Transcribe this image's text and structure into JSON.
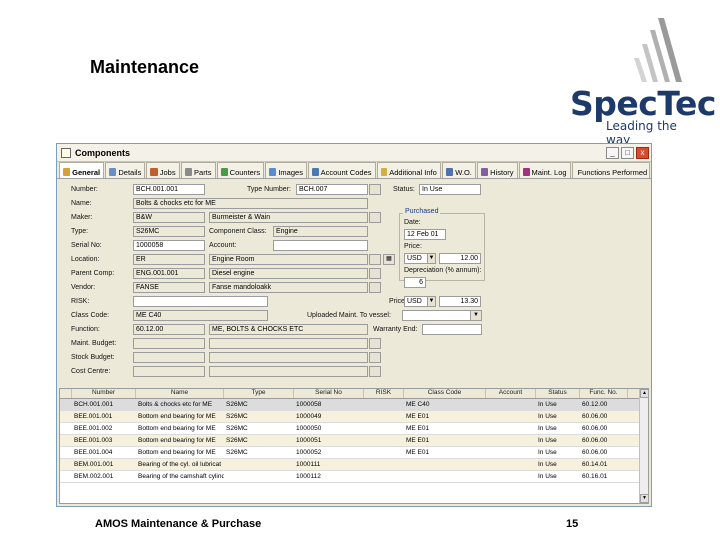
{
  "slide": {
    "title": "Maintenance",
    "footer_left": "AMOS Maintenance & Purchase",
    "page_number": "15"
  },
  "logo": {
    "brand": "SpecTec",
    "tagline": "Leading the way"
  },
  "window": {
    "title": "Components",
    "buttons": {
      "minimize": "_",
      "maximize": "□",
      "close": "x"
    }
  },
  "tabs": [
    {
      "label": "General",
      "icon": "general-icon",
      "color": "#d7a13a"
    },
    {
      "label": "Details",
      "icon": "details-icon",
      "color": "#6b8fc4"
    },
    {
      "label": "Jobs",
      "icon": "jobs-icon",
      "color": "#c06030"
    },
    {
      "label": "Parts",
      "icon": "parts-icon",
      "color": "#8a8a8a"
    },
    {
      "label": "Counters",
      "icon": "counters-icon",
      "color": "#4a9a4a"
    },
    {
      "label": "Images",
      "icon": "images-icon",
      "color": "#5a8ad0"
    },
    {
      "label": "Account Codes",
      "icon": "account-codes-icon",
      "color": "#4a7ab0"
    },
    {
      "label": "Additional Info",
      "icon": "info-icon",
      "color": "#d0b040"
    },
    {
      "label": "W.O.",
      "icon": "work-order-icon",
      "color": "#5070b0"
    },
    {
      "label": "History",
      "icon": "history-icon",
      "color": "#8060a0"
    },
    {
      "label": "Maint. Log",
      "icon": "maint-log-icon",
      "color": "#a03080"
    },
    {
      "label": "Functions Performed",
      "icon": "functions-icon",
      "color": "#409040"
    }
  ],
  "form": {
    "number": {
      "label": "Number:",
      "value": "BCH.001.001"
    },
    "type_number": {
      "label": "Type Number:",
      "value": "BCH.007"
    },
    "status": {
      "label": "Status:",
      "value": "In Use"
    },
    "name": {
      "label": "Name:",
      "value": "Bolts & chocks etc for ME"
    },
    "maker": {
      "label": "Maker:",
      "value": "B&W",
      "extra": "Burmeister & Wain"
    },
    "type": {
      "label": "Type:",
      "value": "S26MC",
      "component_class_label": "Component Class:",
      "component_class": "Engine"
    },
    "serial_no": {
      "label": "Serial No:",
      "value": "1000058",
      "account_label": "Account:",
      "account": ""
    },
    "location": {
      "label": "Location:",
      "value": "ER",
      "extra": "Engine Room"
    },
    "parent_comp": {
      "label": "Parent Comp:",
      "value": "ENG.001.001",
      "extra": "Diesel engine"
    },
    "vendor": {
      "label": "Vendor:",
      "value": "FANSE",
      "extra": "Fanse mandoloakk"
    },
    "risk": {
      "label": "RISK:",
      "value": ""
    },
    "class_code": {
      "label": "Class Code:",
      "value": "ME C40",
      "uploaded_label": "Uploaded Maint. To vessel:"
    },
    "function": {
      "label": "Function:",
      "value": "60.12.00",
      "extra": "ME, BOLTS & CHOCKS ETC",
      "warranty_label": "Warranty End:"
    },
    "maint_budget": {
      "label": "Maint. Budget:"
    },
    "stock_budget": {
      "label": "Stock Budget:"
    },
    "cost_centre": {
      "label": "Cost Centre:"
    },
    "purchased": {
      "title": "Purchased",
      "date_label": "Date:",
      "date": "12 Feb 01",
      "price_label": "Price:",
      "currency": "USD",
      "price": "12.00",
      "depreciation_label": "Depreciation (% annum):",
      "depreciation": "6"
    },
    "price": {
      "label": "Price:",
      "currency": "USD",
      "value": "13.30"
    }
  },
  "grid": {
    "columns": [
      "Number",
      "Name",
      "Type",
      "Serial No",
      "RISK",
      "Class Code",
      "Account",
      "Status",
      "Func. No."
    ],
    "rows": [
      [
        "BCH.001.001",
        "Bolts & chocks etc for ME",
        "S26MC",
        "1000058",
        "",
        "ME C40",
        "",
        "In Use",
        "60.12.00"
      ],
      [
        "BEE.001.001",
        "Bottom end bearing for ME",
        "S26MC",
        "1000049",
        "",
        "ME E01",
        "",
        "In Use",
        "60.06.00"
      ],
      [
        "BEE.001.002",
        "Bottom end bearing for ME",
        "S26MC",
        "1000050",
        "",
        "ME E01",
        "",
        "In Use",
        "60.06.00"
      ],
      [
        "BEE.001.003",
        "Bottom end bearing for ME",
        "S26MC",
        "1000051",
        "",
        "ME E01",
        "",
        "In Use",
        "60.06.00"
      ],
      [
        "BEE.001.004",
        "Bottom end bearing for ME",
        "S26MC",
        "1000052",
        "",
        "ME E01",
        "",
        "In Use",
        "60.06.00"
      ],
      [
        "BEM.001.001",
        "Bearing of the cyl. oil lubricat",
        "",
        "1000111",
        "",
        "",
        "",
        "In Use",
        "60.14.01"
      ],
      [
        "BEM.002.001",
        "Bearing of the camshaft cylinde",
        "",
        "1000112",
        "",
        "",
        "",
        "In Use",
        "60.16.01"
      ]
    ]
  }
}
